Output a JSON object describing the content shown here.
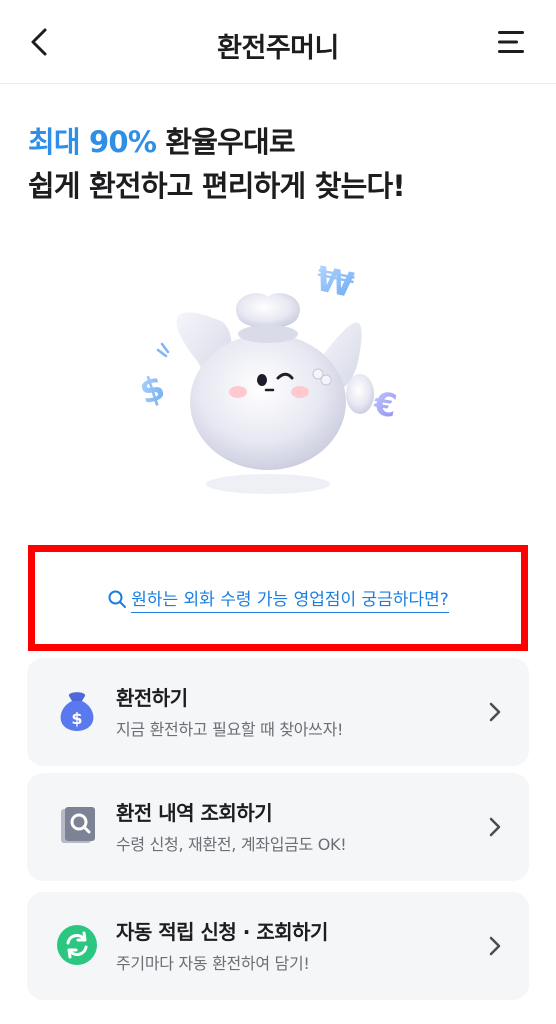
{
  "header": {
    "title": "환전주머니",
    "back_icon": "chevron-left-icon",
    "menu_icon": "hamburger-menu-icon"
  },
  "headline": {
    "accent": "최대 90%",
    "line1_rest": " 환율우대로",
    "line2": "쉽게 환전하고 편리하게 찾는다!",
    "accent_color": "#2f8fe6"
  },
  "search_link": {
    "label": "원하는 외화 수령 가능 영업점이 궁금하다면?",
    "icon": "search-icon",
    "color": "#1a7fe0"
  },
  "cards": [
    {
      "title": "환전하기",
      "desc": "지금 환전하고 필요할 때 찾아쓰자!",
      "icon": "money-bag-icon"
    },
    {
      "title": "환전 내역 조회하기",
      "desc": "수령 신청, 재환전, 계좌입금도 OK!",
      "icon": "document-search-icon"
    },
    {
      "title": "자동 적립 신청 · 조회하기",
      "desc": "주기마다 자동 환전하여 담기!",
      "icon": "refresh-icon"
    }
  ]
}
